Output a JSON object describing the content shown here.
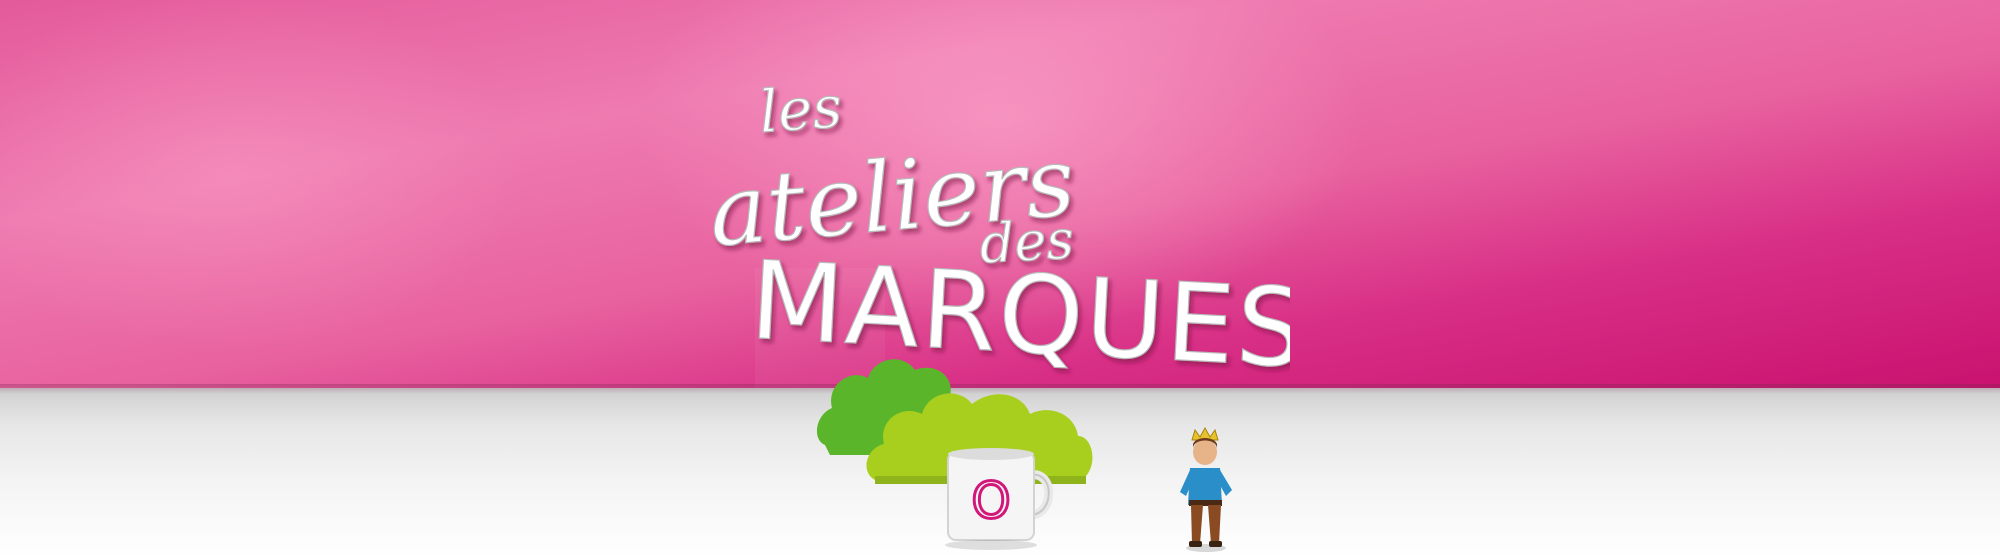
{
  "logo": {
    "line1": "les",
    "line2": "ateliers",
    "line3": "des",
    "line4": "MARQUES"
  },
  "mug": {
    "letter": "O"
  },
  "colors": {
    "pink_dark": "#c9126f",
    "pink_light": "#ee7ab0",
    "bush_dark": "#5bb52a",
    "bush_light": "#a8cf1e",
    "logo_white": "#ffffff"
  },
  "icons": [
    "green-bush-icon",
    "mug-icon",
    "king-figurine-icon"
  ]
}
